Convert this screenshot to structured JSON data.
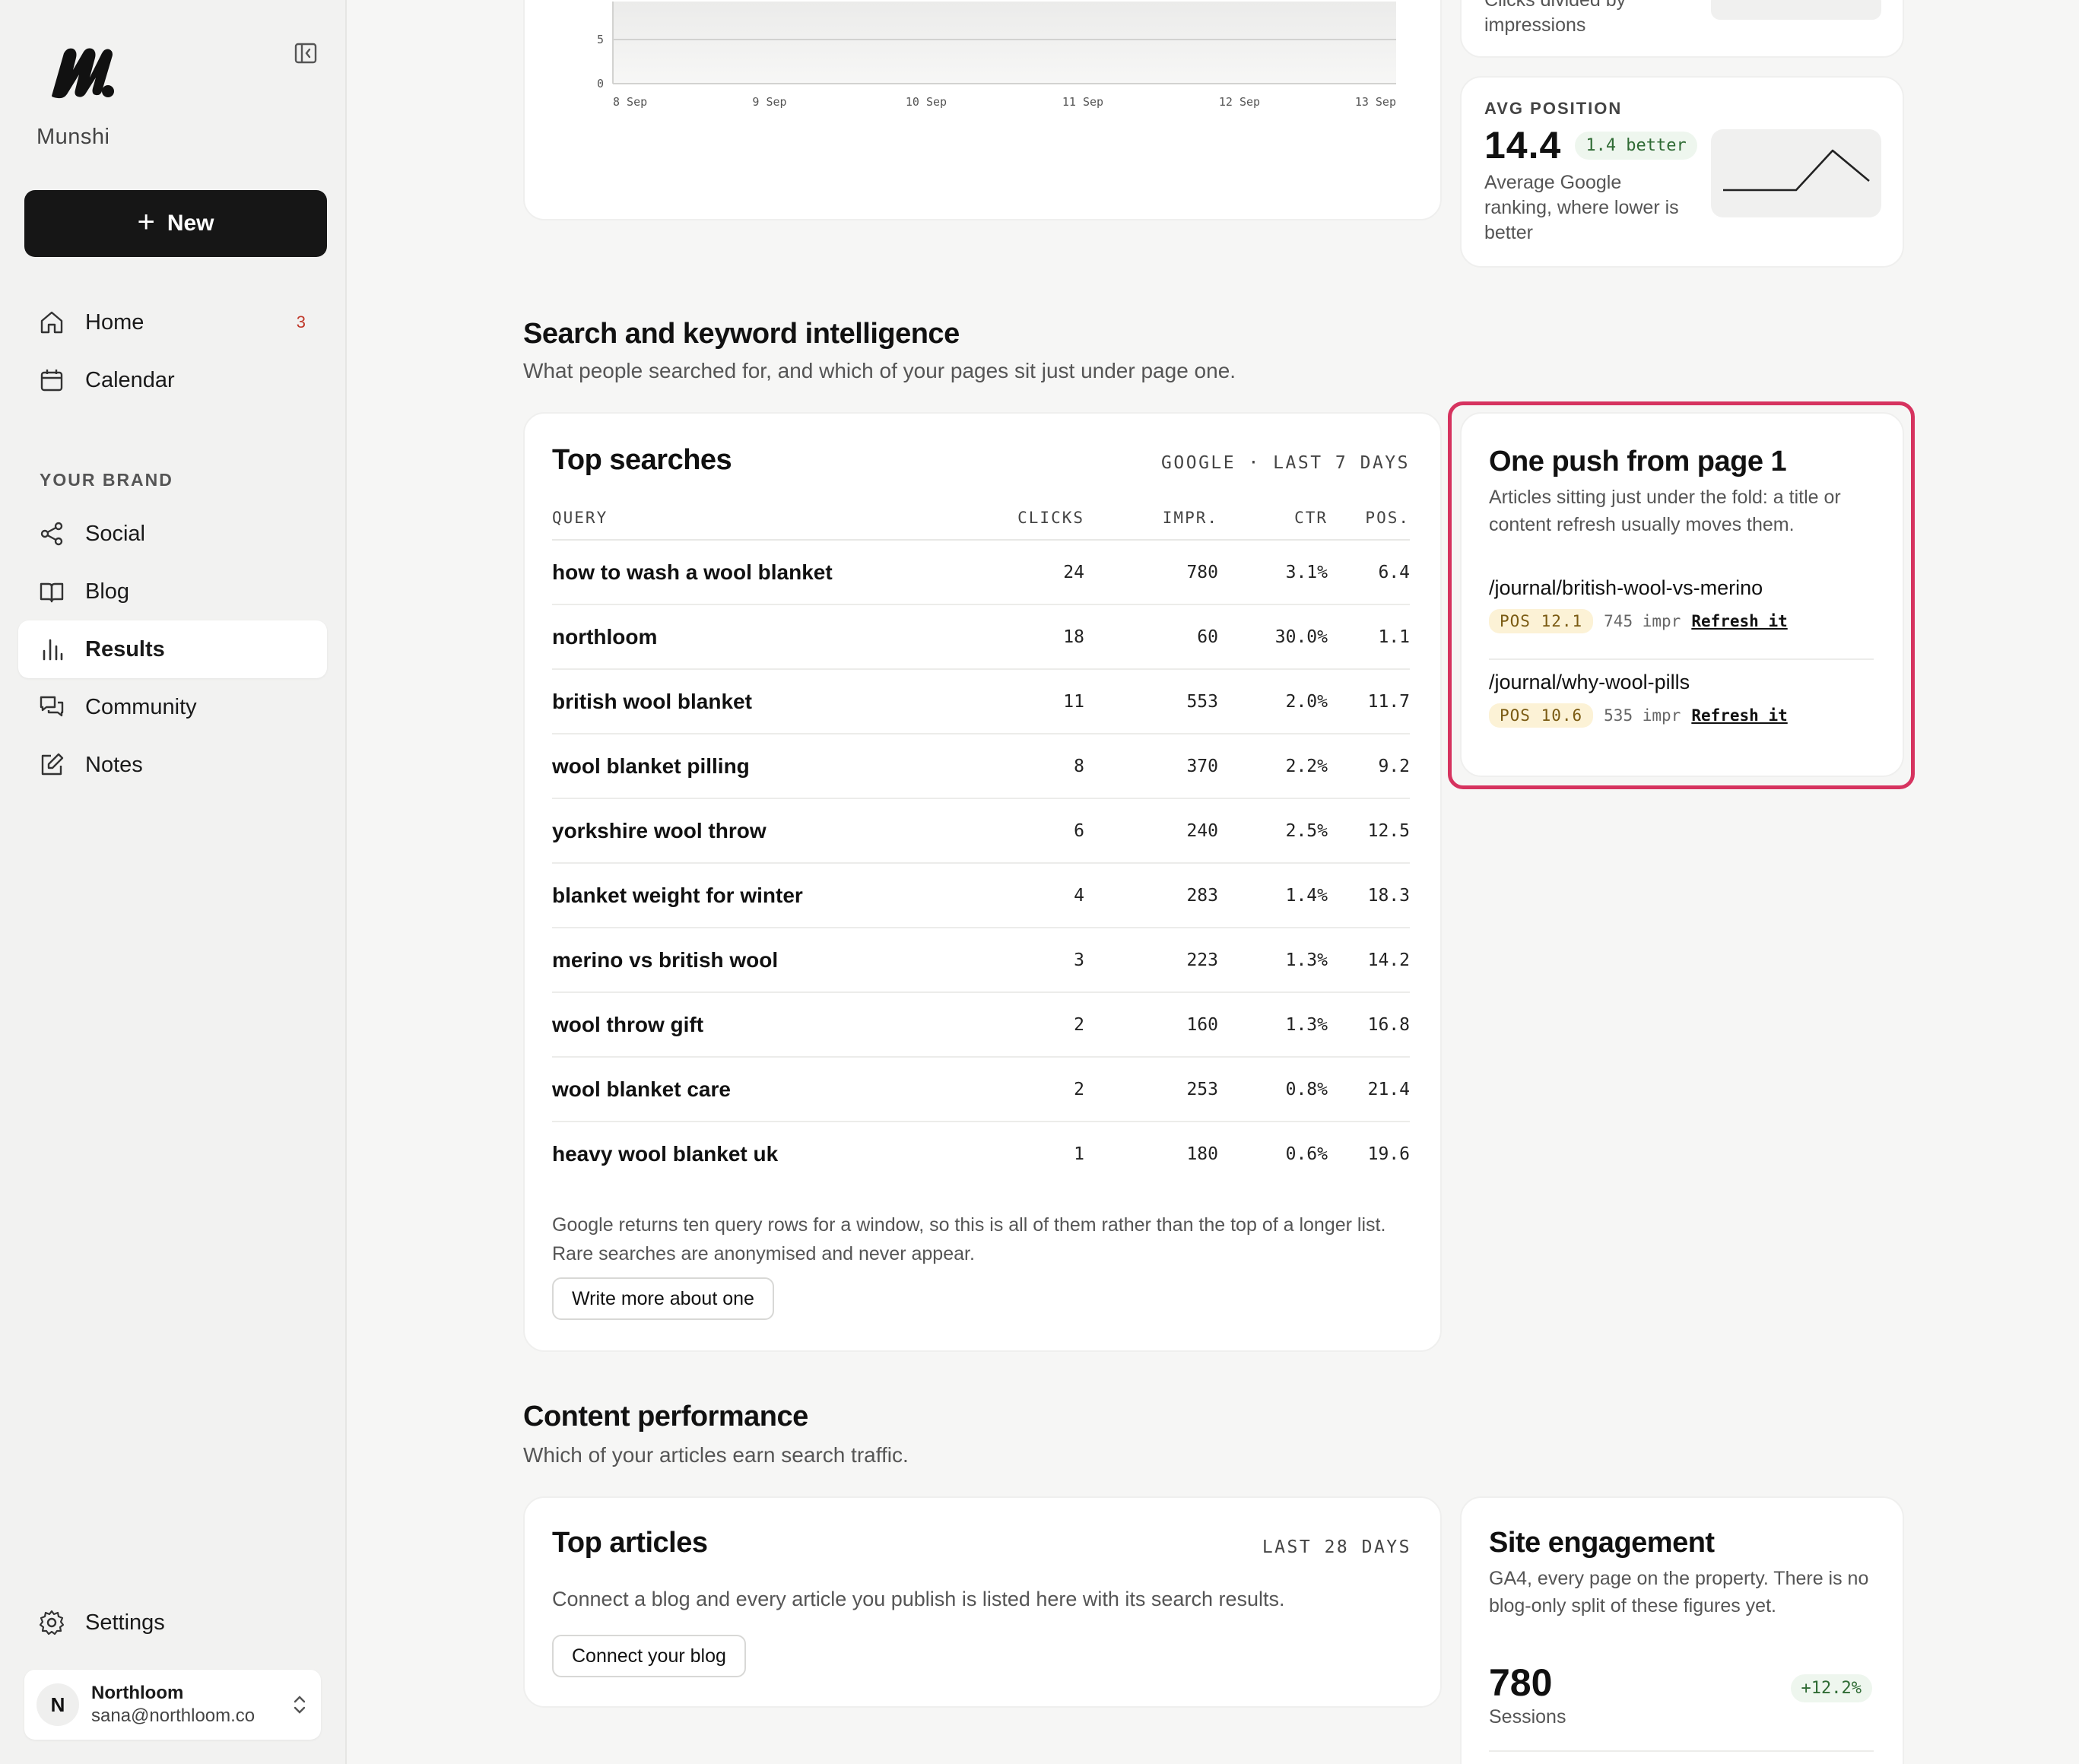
{
  "sidebar": {
    "brand_name": "Munshi",
    "new_label": "New",
    "nav": [
      {
        "label": "Home",
        "badge": "3"
      },
      {
        "label": "Calendar"
      }
    ],
    "section_label": "YOUR BRAND",
    "brand_nav": [
      {
        "label": "Social"
      },
      {
        "label": "Blog"
      },
      {
        "label": "Results"
      },
      {
        "label": "Community"
      },
      {
        "label": "Notes"
      }
    ],
    "settings_label": "Settings",
    "account": {
      "initial": "N",
      "name": "Northloom",
      "email": "sana@northloom.co"
    }
  },
  "chart_data": {
    "type": "area",
    "x": [
      "8 Sep",
      "9 Sep",
      "10 Sep",
      "11 Sep",
      "12 Sep",
      "13 Sep"
    ],
    "y_ticks": [
      "5",
      "0"
    ],
    "grid": true
  },
  "ctr_card": {
    "desc_partial": "Clicks divided by",
    "desc_line2": "impressions"
  },
  "avg_position": {
    "label": "AVG POSITION",
    "value": "14.4",
    "delta": "1.4 better",
    "desc": "Average Google ranking, where lower is better",
    "sparkline": [
      0.25,
      0.25,
      0.25,
      0.9,
      0.4
    ]
  },
  "search_section": {
    "title": "Search and keyword intelligence",
    "subtitle": "What people searched for, and which of your pages sit just under page one."
  },
  "top_searches": {
    "title": "Top searches",
    "meta": "GOOGLE · LAST 7 DAYS",
    "columns": [
      "QUERY",
      "CLICKS",
      "IMPR.",
      "CTR",
      "POS."
    ],
    "rows": [
      {
        "query": "how to wash a wool blanket",
        "clicks": "24",
        "impr": "780",
        "ctr": "3.1%",
        "pos": "6.4"
      },
      {
        "query": "northloom",
        "clicks": "18",
        "impr": "60",
        "ctr": "30.0%",
        "pos": "1.1"
      },
      {
        "query": "british wool blanket",
        "clicks": "11",
        "impr": "553",
        "ctr": "2.0%",
        "pos": "11.7"
      },
      {
        "query": "wool blanket pilling",
        "clicks": "8",
        "impr": "370",
        "ctr": "2.2%",
        "pos": "9.2"
      },
      {
        "query": "yorkshire wool throw",
        "clicks": "6",
        "impr": "240",
        "ctr": "2.5%",
        "pos": "12.5"
      },
      {
        "query": "blanket weight for winter",
        "clicks": "4",
        "impr": "283",
        "ctr": "1.4%",
        "pos": "18.3"
      },
      {
        "query": "merino vs british wool",
        "clicks": "3",
        "impr": "223",
        "ctr": "1.3%",
        "pos": "14.2"
      },
      {
        "query": "wool throw gift",
        "clicks": "2",
        "impr": "160",
        "ctr": "1.3%",
        "pos": "16.8"
      },
      {
        "query": "wool blanket care",
        "clicks": "2",
        "impr": "253",
        "ctr": "0.8%",
        "pos": "21.4"
      },
      {
        "query": "heavy wool blanket uk",
        "clicks": "1",
        "impr": "180",
        "ctr": "0.6%",
        "pos": "19.6"
      }
    ],
    "footnote_line1": "Google returns ten query rows for a window, so this is all of them rather than the top of a longer list.",
    "footnote_line2": "Rare searches are anonymised and never appear.",
    "button": "Write more about one"
  },
  "one_push": {
    "title": "One push from page 1",
    "desc": "Articles sitting just under the fold: a title or content refresh usually moves them.",
    "items": [
      {
        "path": "/journal/british-wool-vs-merino",
        "pos": "POS 12.1",
        "impr": "745 impr",
        "action": "Refresh it"
      },
      {
        "path": "/journal/why-wool-pills",
        "pos": "POS 10.6",
        "impr": "535 impr",
        "action": "Refresh it"
      }
    ],
    "highlight_color": "#d6335f"
  },
  "content_section": {
    "title": "Content performance",
    "subtitle": "Which of your articles earn search traffic."
  },
  "top_articles": {
    "title": "Top articles",
    "meta": "LAST 28 DAYS",
    "desc": "Connect a blog and every article you publish is listed here with its search results.",
    "button": "Connect your blog"
  },
  "site_engagement": {
    "title": "Site engagement",
    "desc": "GA4, every page on the property. There is no blog-only split of these figures yet.",
    "value": "780",
    "label": "Sessions",
    "delta": "+12.2%"
  }
}
